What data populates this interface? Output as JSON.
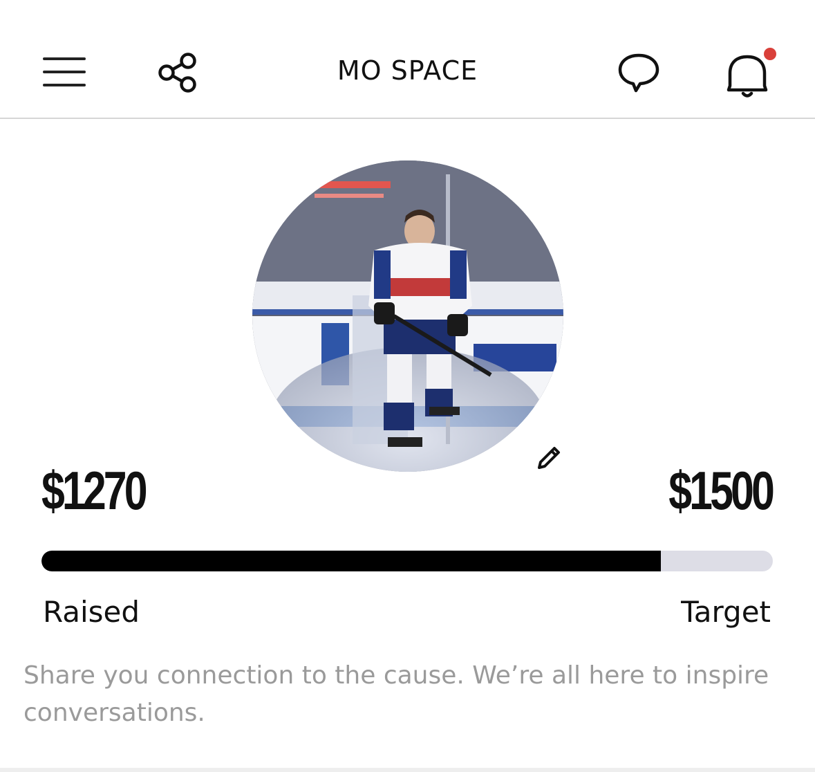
{
  "header": {
    "title": "MO SPACE",
    "menu_icon": "hamburger-menu-icon",
    "share_icon": "share-icon",
    "chat_icon": "chat-bubble-icon",
    "bell_icon": "bell-icon",
    "notification_dot_color": "#d9403a"
  },
  "profile": {
    "avatar_description": "photo",
    "edit_icon": "pencil-icon"
  },
  "fundraising": {
    "raised_amount": "$1270",
    "target_amount": "$1500",
    "raised_label": "Raised",
    "target_label": "Target",
    "progress_fraction": 0.847
  },
  "message": "Share you connection to the cause. We’re all here to inspire conversations.",
  "colors": {
    "progress_fill": "#000000",
    "progress_track": "#dddde6",
    "message_text": "#9a9a9a"
  }
}
